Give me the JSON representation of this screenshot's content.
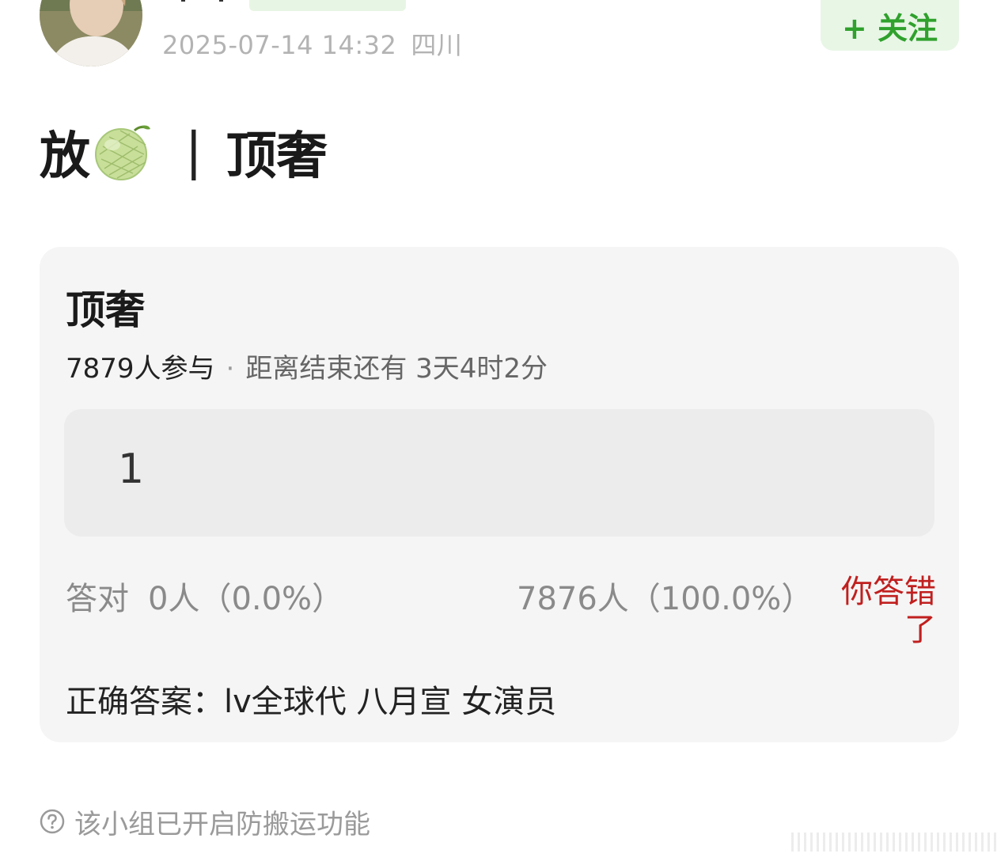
{
  "header": {
    "timestamp": "2025-07-14 14:32",
    "location": "四川",
    "follow_label": "+ 关注"
  },
  "post": {
    "title_prefix": "放",
    "title_emoji": "melon-icon",
    "title_separator": "|",
    "title_suffix": "顶奢"
  },
  "quiz": {
    "title": "顶奢",
    "participants": "7879人参与",
    "separator": "·",
    "remaining": "距离结束还有 3天4时2分",
    "option_text": "1",
    "correct_label": "答对",
    "correct_count": "0人（0.0%）",
    "wrong_count": "7876人（100.0%）",
    "wrong_note": "你答错了",
    "answer": "正确答案：lv全球代 八月宣 女演员"
  },
  "footer": {
    "help_icon": "question-circle-icon",
    "note": "该小组已开启防搬运功能"
  },
  "colors": {
    "accent_green": "#2fa12c",
    "follow_bg": "#e8f6e6",
    "wrong_red": "#c0201f",
    "card_bg": "#f5f5f5"
  }
}
